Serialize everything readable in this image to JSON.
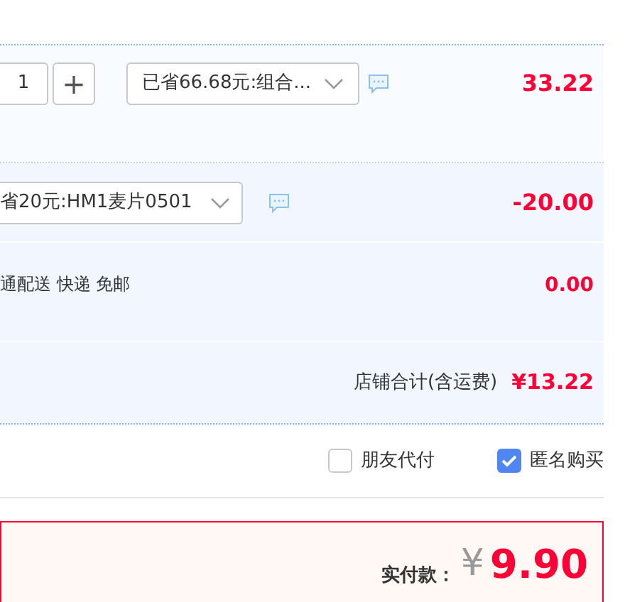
{
  "item": {
    "quantity": "1",
    "plus": "+",
    "promo": "已省66.68元:组合...",
    "price": "33.22"
  },
  "discount": {
    "promo": "省20元:HM1麦片0501",
    "amount": "-20.00"
  },
  "shipping": {
    "method": "通配送 快递 免邮",
    "fee": "0.00"
  },
  "shop_total": {
    "label": "店铺合计(含运费)",
    "amount": "¥13.22"
  },
  "options": [
    {
      "label": "朋友代付",
      "checked": false
    },
    {
      "label": "匿名购买",
      "checked": true
    }
  ],
  "payment": {
    "label": "实付款：",
    "currency": "¥",
    "amount": "9.90"
  }
}
